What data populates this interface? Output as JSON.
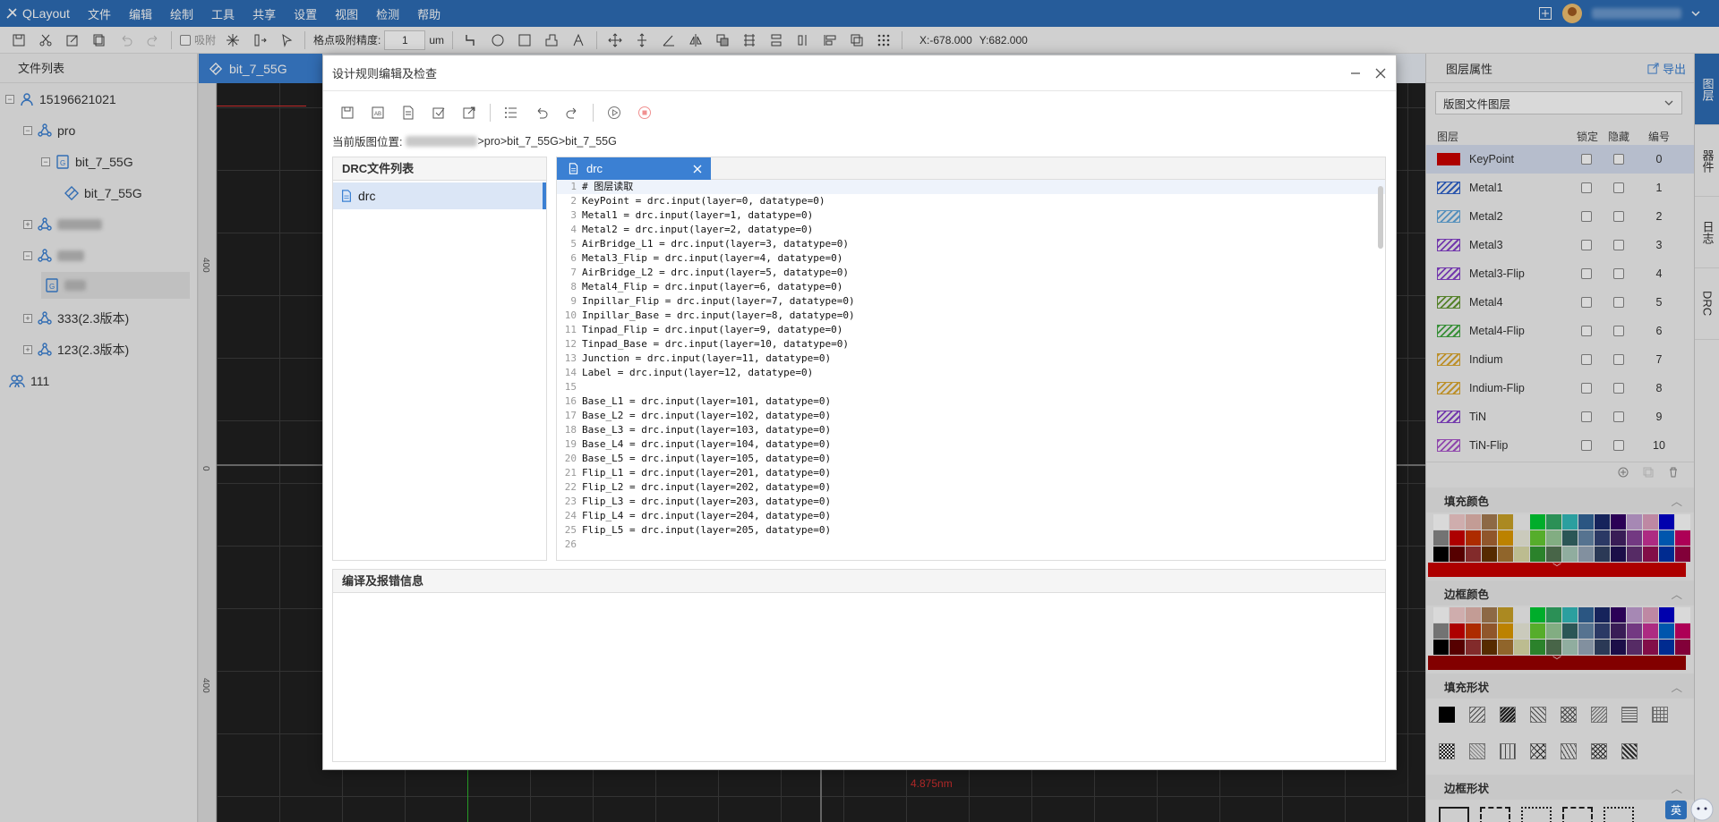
{
  "app": {
    "title": "QLayout"
  },
  "menu": [
    "文件",
    "编辑",
    "绘制",
    "工具",
    "共享",
    "设置",
    "视图",
    "检测",
    "帮助"
  ],
  "toolbar": {
    "snap_label": "吸附",
    "precision_label": "格点吸附精度:",
    "precision_value": "1",
    "unit": "um",
    "coord_x": "X:-678.000",
    "coord_y": "Y:682.000"
  },
  "file_panel": {
    "title": "文件列表",
    "user": "15196621021",
    "project": "pro",
    "layout_file": "bit_7_55G",
    "cell": "bit_7_55G",
    "proj333": "333(2.3版本)",
    "proj123": "123(2.3版本)",
    "team": "111"
  },
  "layout_tab": {
    "label": "bit_7_55G"
  },
  "ruler": {
    "mark1": "400",
    "mark2": "0",
    "mark3": "400"
  },
  "canvas_label": "4.875nm",
  "dialog": {
    "title": "设计规则编辑及检查",
    "path_label": "当前版图位置:",
    "path_value": ">pro>bit_7_55G>bit_7_55G",
    "file_list_title": "DRC文件列表",
    "file_item": "drc",
    "editor_tab": "drc",
    "message_title": "编译及报错信息",
    "code_lines": [
      "# 图层读取",
      "KeyPoint = drc.input(layer=0, datatype=0)",
      "Metal1 = drc.input(layer=1, datatype=0)",
      "Metal2 = drc.input(layer=2, datatype=0)",
      "AirBridge_L1 = drc.input(layer=3, datatype=0)",
      "Metal3_Flip = drc.input(layer=4, datatype=0)",
      "AirBridge_L2 = drc.input(layer=5, datatype=0)",
      "Metal4_Flip = drc.input(layer=6, datatype=0)",
      "Inpillar_Flip = drc.input(layer=7, datatype=0)",
      "Inpillar_Base = drc.input(layer=8, datatype=0)",
      "Tinpad_Flip = drc.input(layer=9, datatype=0)",
      "Tinpad_Base = drc.input(layer=10, datatype=0)",
      "Junction = drc.input(layer=11, datatype=0)",
      "Label = drc.input(layer=12, datatype=0)",
      "",
      "Base_L1 = drc.input(layer=101, datatype=0)",
      "Base_L2 = drc.input(layer=102, datatype=0)",
      "Base_L3 = drc.input(layer=103, datatype=0)",
      "Base_L4 = drc.input(layer=104, datatype=0)",
      "Base_L5 = drc.input(layer=105, datatype=0)",
      "Flip_L1 = drc.input(layer=201, datatype=0)",
      "Flip_L2 = drc.input(layer=202, datatype=0)",
      "Flip_L3 = drc.input(layer=203, datatype=0)",
      "Flip_L4 = drc.input(layer=204, datatype=0)",
      "Flip_L5 = drc.input(layer=205, datatype=0)",
      ""
    ]
  },
  "layer_panel": {
    "title": "图层属性",
    "export_label": "导出",
    "select_value": "版图文件图层",
    "col_layer": "图层",
    "col_lock": "锁定",
    "col_hide": "隐藏",
    "col_num": "编号",
    "layers": [
      {
        "name": "KeyPoint",
        "num": "0",
        "color": "#cc0000"
      },
      {
        "name": "Metal1",
        "num": "1",
        "color": "#3366cc"
      },
      {
        "name": "Metal2",
        "num": "2",
        "color": "#66aadd"
      },
      {
        "name": "Metal3",
        "num": "3",
        "color": "#8844cc"
      },
      {
        "name": "Metal3-Flip",
        "num": "4",
        "color": "#8844cc"
      },
      {
        "name": "Metal4",
        "num": "5",
        "color": "#669933"
      },
      {
        "name": "Metal4-Flip",
        "num": "6",
        "color": "#44aa44"
      },
      {
        "name": "Indium",
        "num": "7",
        "color": "#ddaa33"
      },
      {
        "name": "Indium-Flip",
        "num": "8",
        "color": "#ddaa33"
      },
      {
        "name": "TiN",
        "num": "9",
        "color": "#8844cc"
      },
      {
        "name": "TiN-Flip",
        "num": "10",
        "color": "#aa55cc"
      }
    ],
    "fill_color_title": "填充颜色",
    "border_color_title": "边框颜色",
    "fill_shape_title": "填充形状",
    "border_shape_title": "边框形状",
    "fill_selected": "#cc0000",
    "border_selected": "#990000"
  },
  "side_tabs": [
    "图层",
    "器件",
    "日志",
    "DRC"
  ],
  "ime": "英"
}
